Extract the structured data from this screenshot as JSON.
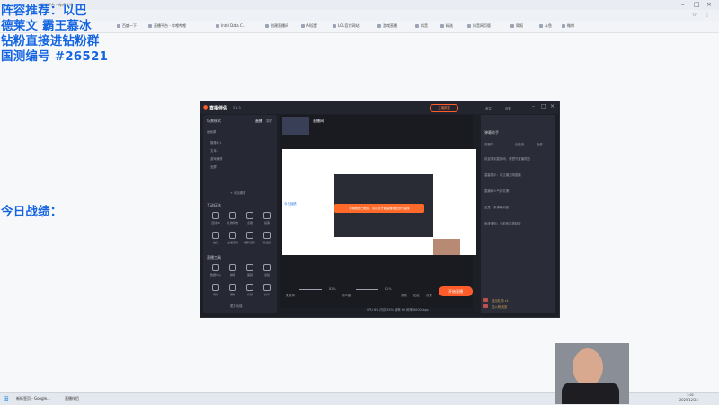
{
  "browser": {
    "tabs": [
      "直播平台 - 哔哩哔哩"
    ],
    "bookmarks": [
      "百度一下",
      "直播平台 - 哔哩哔哩",
      "Intel Data C...",
      "创建直播间",
      "AI设置",
      "LOL官方网站",
      "游戏直播",
      "抖音",
      "精选",
      "抖音网页版",
      "简报",
      "斗鱼",
      "微博"
    ]
  },
  "overlay": {
    "line1": "阵容推荐：以巴",
    "line2": "德莱文  霸王慕冰",
    "line3": "钻粉直接进钻粉群",
    "line4": "国测编号 #26521",
    "line5": "今日战绩："
  },
  "app": {
    "title": "直播伴侣",
    "version": "5.1.3",
    "header_buttons": [
      "主播数据",
      "收益",
      "设置"
    ],
    "left_panel": {
      "scene_header": "场景模式",
      "tab_live": "直播",
      "tab_record": "录屏",
      "sources_title": "画面源",
      "sources": [
        "摄像头1",
        "文本1",
        "游戏捕获",
        "全屏"
      ],
      "add_source": "+ 添加素材",
      "interact_title": "互动玩法",
      "interact_items": [
        "连线PK",
        "礼物特效",
        "点歌",
        "投票",
        "抽奖",
        "主播签到",
        "福利任务",
        "粉丝团"
      ],
      "tools_title": "直播工具",
      "tool_items": [
        "数据中心",
        "弹幕",
        "美颜",
        "滤镜",
        "场景",
        "录制",
        "房管",
        "分享"
      ],
      "more_tools": "更多功能"
    },
    "center": {
      "stream_title": "直播间:",
      "preview_text": "今日战绩：",
      "toast": "基础画面已就绪，请点击开始直播按钮进行直播",
      "mic_label": "麦克风",
      "mic_pct": "82%",
      "speaker_label": "扬声器",
      "speaker_pct": "82%",
      "tools": [
        "美颜",
        "贴纸",
        "设置"
      ],
      "start_button": "开始直播"
    },
    "right_panel": {
      "header": "弹幕助手",
      "tabs": [
        "开播中",
        "已结束",
        "全部"
      ],
      "messages": [
        "欢迎来到直播间，请遵守直播规范",
        "温馨提示：请主播文明直播",
        "直播间人气排名第1",
        "这是一条弹幕消息",
        "系统通知：当前有礼物特效"
      ],
      "user_rows": [
        "送出礼物 x1",
        "加入粉丝团"
      ]
    },
    "statusbar": "CPU 8%  内存 35%  帧率 60  码率 6000kbps"
  },
  "taskbar": {
    "items": [
      "新标签页 - Google...",
      "直播伴侣"
    ],
    "time": "1:01",
    "date": "2025/12/23"
  },
  "colors": {
    "overlay_text": "#1565e0",
    "accent": "#ff5c2a",
    "app_bg": "#1d1f26"
  }
}
